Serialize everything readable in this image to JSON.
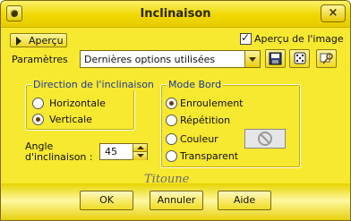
{
  "window": {
    "title": "Inclinaison",
    "close_label": "×"
  },
  "preview": {
    "toggle_label": "Aperçu",
    "show_image_label": "Aperçu de l'image",
    "show_image_checked": true
  },
  "params": {
    "label": "Paramètres",
    "preset_value": "Dernières options utilisées",
    "icons": [
      "save-preset-icon",
      "dice-random-icon",
      "reset-key-icon"
    ]
  },
  "direction": {
    "legend": "Direction de l'inclinaison",
    "options": [
      {
        "label": "Horizontale",
        "selected": false
      },
      {
        "label": "Verticale",
        "selected": true
      }
    ]
  },
  "angle": {
    "label_line1": "Angle",
    "label_line2": "d'inclinaison :",
    "value": "45"
  },
  "edge_mode": {
    "legend": "Mode Bord",
    "options": [
      {
        "label": "Enroulement",
        "selected": true
      },
      {
        "label": "Répétition",
        "selected": false
      },
      {
        "label": "Couleur",
        "selected": false
      },
      {
        "label": "Transparent",
        "selected": false
      }
    ]
  },
  "signature": "Titoune",
  "actions": {
    "ok": "OK",
    "cancel": "Annuler",
    "help": "Aide"
  },
  "colors": {
    "accent": "#f7e830",
    "legend_text": "#1c3a9a",
    "border": "#7a6a10"
  }
}
